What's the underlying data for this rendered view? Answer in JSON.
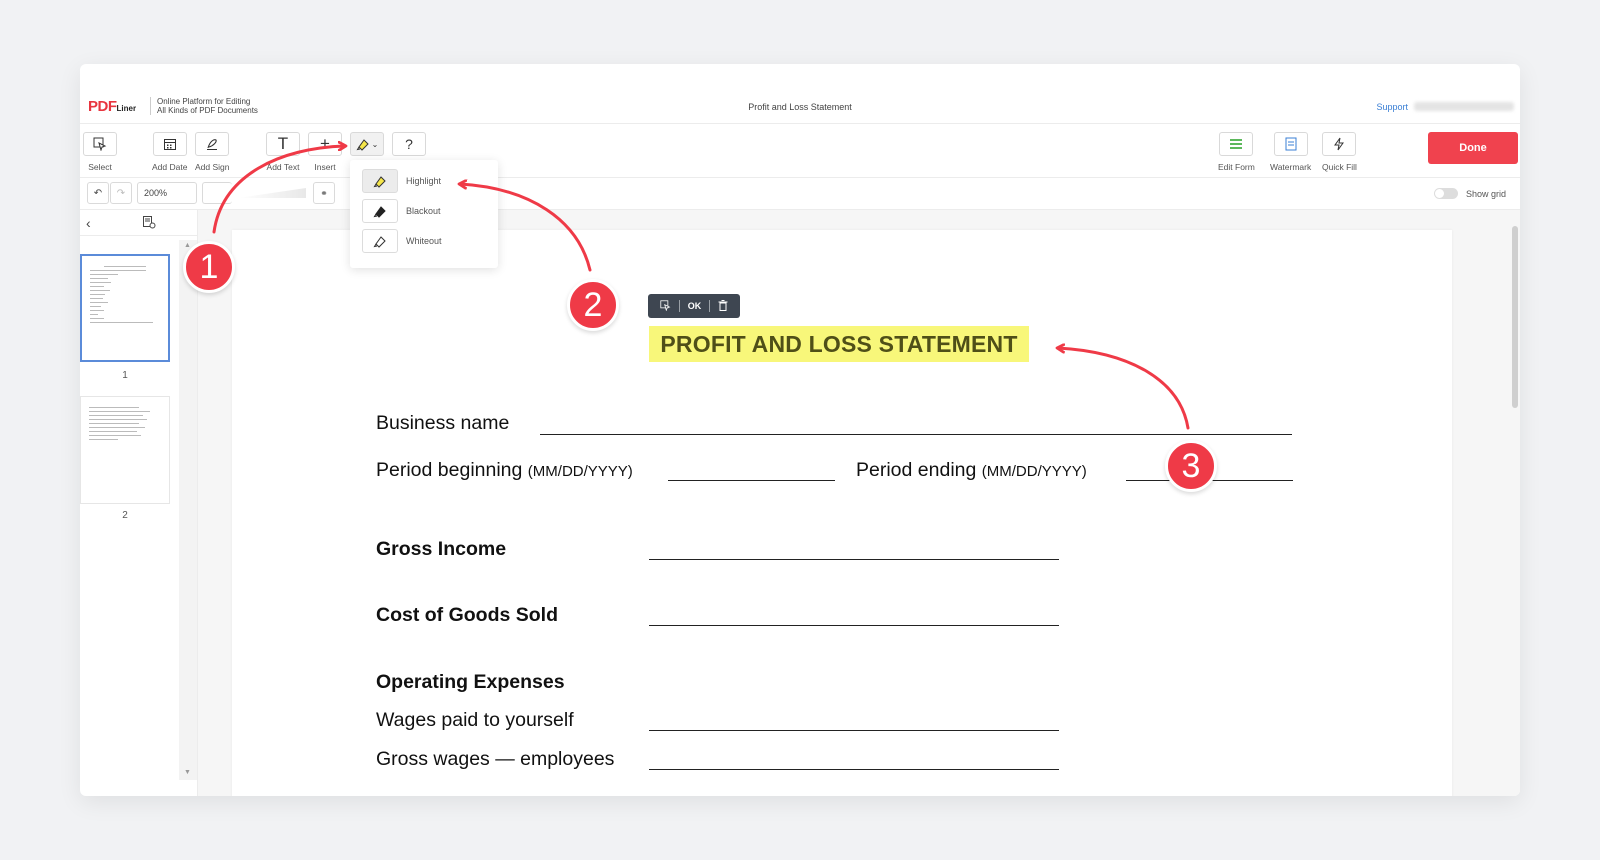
{
  "header": {
    "logo_main": "PDF",
    "logo_sub": "Liner",
    "tagline_line1": "Online Platform for Editing",
    "tagline_line2": "All Kinds of PDF Documents",
    "document_title": "Profit and Loss Statement",
    "support_label": "Support"
  },
  "toolbar": {
    "select_label": "Select",
    "add_date_label": "Add Date",
    "add_sign_label": "Add Sign",
    "add_text_label": "Add Text",
    "insert_label": "Insert",
    "help_label": "?",
    "edit_form_label": "Edit Form",
    "watermark_label": "Watermark",
    "quick_fill_label": "Quick Fill",
    "done_label": "Done"
  },
  "toolbar2": {
    "zoom_value": "200%",
    "show_grid_label": "Show grid"
  },
  "sidebar": {
    "pages": [
      {
        "number": "1"
      },
      {
        "number": "2"
      }
    ]
  },
  "dropdown": {
    "items": [
      {
        "label": "Highlight"
      },
      {
        "label": "Blackout"
      },
      {
        "label": "Whiteout"
      }
    ]
  },
  "selection_toolbar": {
    "ok_label": "OK"
  },
  "document": {
    "title": "PROFIT AND LOSS STATEMENT",
    "business_name_label": "Business name",
    "period_beginning_label": "Period beginning",
    "period_beginning_format": "(MM/DD/YYYY)",
    "period_ending_label": "Period ending",
    "period_ending_format": "(MM/DD/YYYY)",
    "gross_income_label": "Gross Income",
    "cogs_label": "Cost of Goods Sold",
    "operating_expenses_label": "Operating Expenses",
    "wages_self_label": "Wages paid to yourself",
    "wages_employees_label": "Gross wages — employees"
  },
  "annotations": {
    "step1": "1",
    "step2": "2",
    "step3": "3",
    "accent_color": "#ef3a47"
  },
  "colors": {
    "brand": "#e8353f",
    "done_button": "#f0424e",
    "highlight": "#f8f77a",
    "link": "#3a7fd5"
  }
}
